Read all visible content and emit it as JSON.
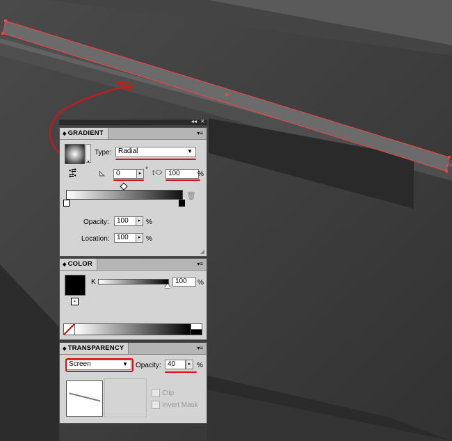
{
  "gradient": {
    "tab": "GRADIENT",
    "type_label": "Type:",
    "type_value": "Radial",
    "angle_value": "0",
    "angle_unit": "°",
    "aspect_value": "100",
    "aspect_unit": "%",
    "opacity_label": "Opacity:",
    "opacity_value": "100",
    "opacity_unit": "%",
    "location_label": "Location:",
    "location_value": "100",
    "location_unit": "%"
  },
  "color": {
    "tab": "COLOR",
    "channel_label": "K",
    "channel_value": "100",
    "channel_unit": "%",
    "slider_position": 1.0
  },
  "transparency": {
    "tab": "TRANSPARENCY",
    "blend_mode": "Screen",
    "opacity_label": "Opacity:",
    "opacity_value": "40",
    "opacity_unit": "%",
    "clip_label": "Clip",
    "invert_mask_label": "Invert Mask"
  },
  "colors": {
    "annotation": "#dd1111",
    "selection": "#ff4040",
    "panel_bg": "#d4d4d4"
  },
  "icons": [
    "collapse-arrows-icon",
    "panel-menu-icon",
    "swap-gradient-icon",
    "angle-icon",
    "aspect-ratio-icon",
    "trash-icon",
    "fill-swatch-icon",
    "none-swatch-icon"
  ]
}
